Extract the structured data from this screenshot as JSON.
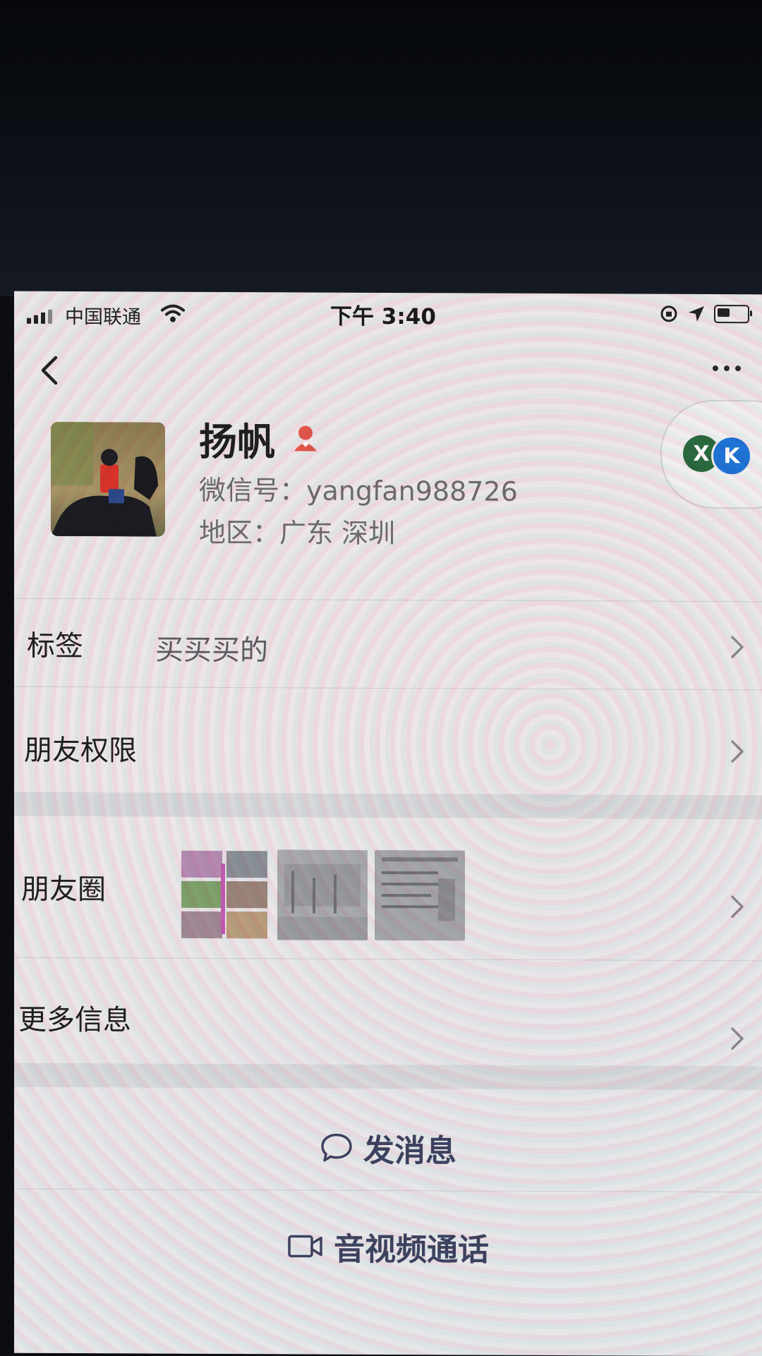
{
  "status_bar": {
    "carrier": "中国联通",
    "time": "下午 3:40"
  },
  "profile": {
    "name": "扬帆",
    "wechat_id": "微信号：yangfan988726",
    "region": "地区：广东 深圳"
  },
  "rows": {
    "tags_label": "标签",
    "tags_value": "买买买的",
    "permissions_label": "朋友权限",
    "moments_label": "朋友圈",
    "more_info_label": "更多信息"
  },
  "actions": {
    "message_label": "发消息",
    "call_label": "音视频通话"
  },
  "badge": {
    "left_letter": "X",
    "right_letter": "K"
  },
  "icons": {
    "back": "chevron-left-icon",
    "more": "more-dots-icon",
    "gender": "female-icon",
    "message": "chat-bubble-icon",
    "call": "video-camera-icon"
  }
}
